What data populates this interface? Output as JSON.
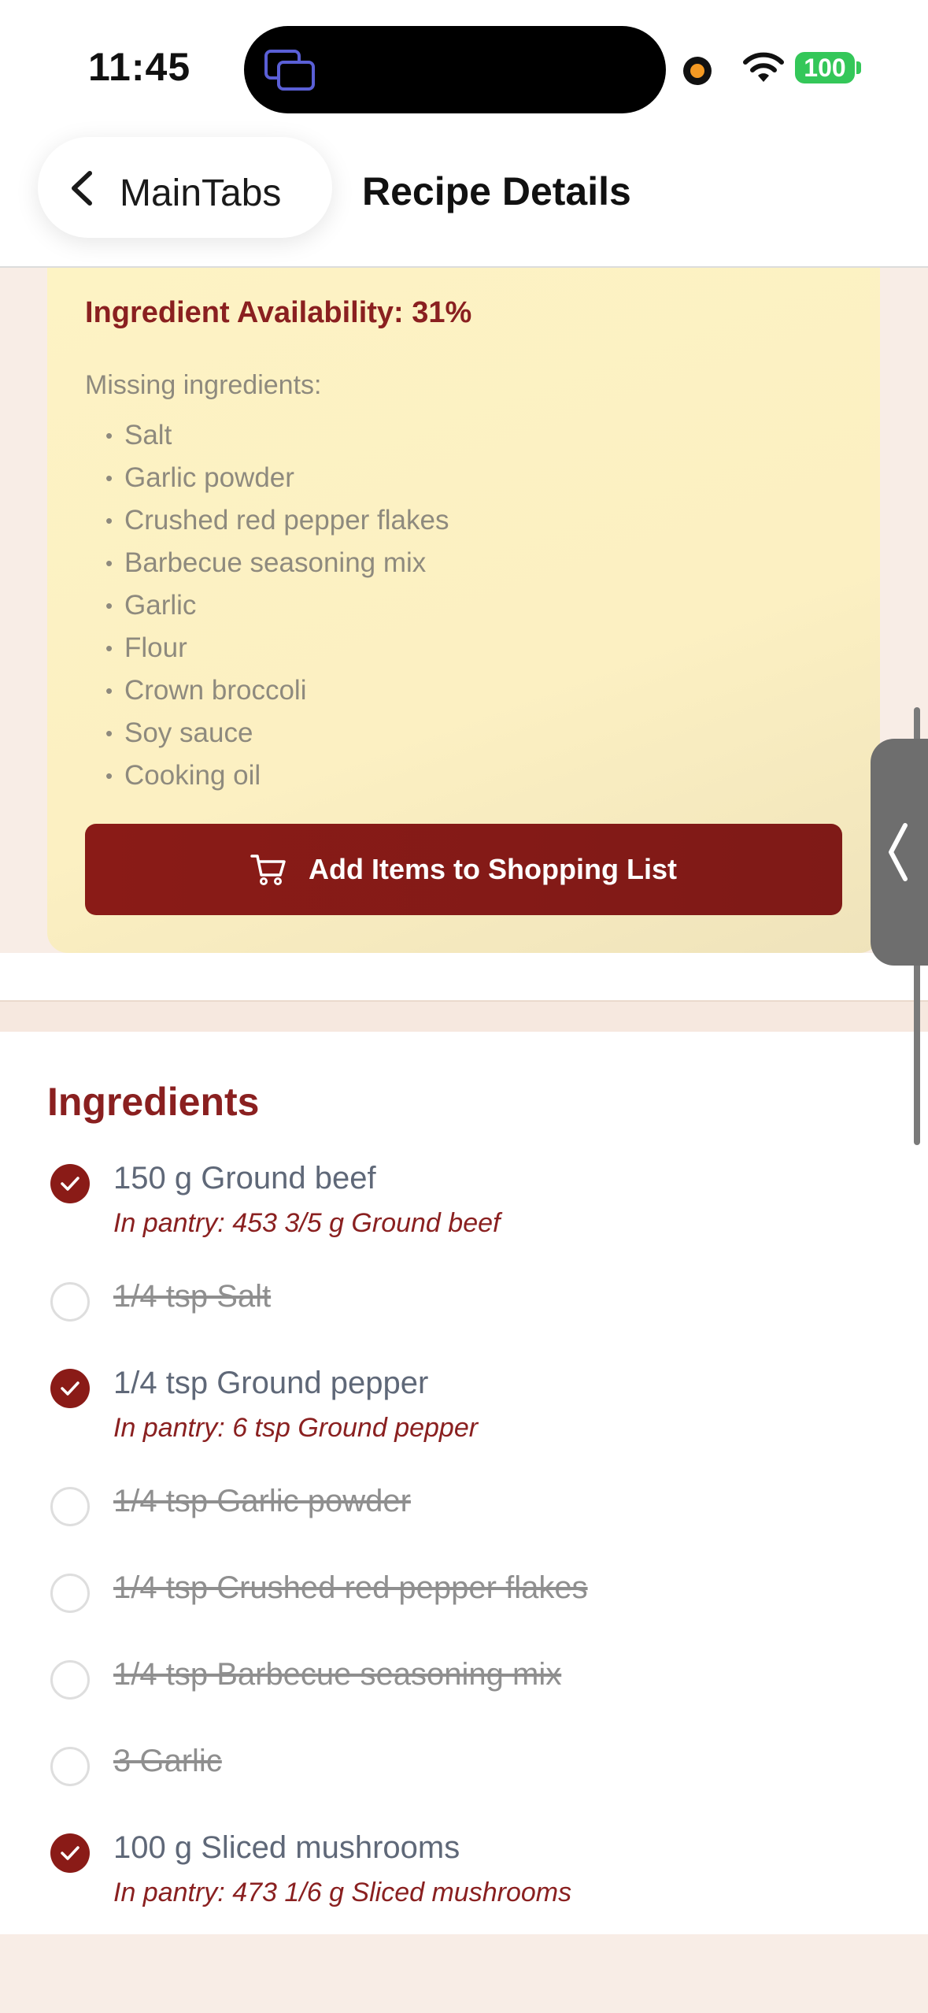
{
  "status_bar": {
    "time": "11:45",
    "battery": "100"
  },
  "nav": {
    "back_label": "MainTabs",
    "title": "Recipe Details"
  },
  "availability": {
    "title": "Ingredient Availability: 31%",
    "missing_label": "Missing ingredients:",
    "missing": [
      "Salt",
      "Garlic powder",
      "Crushed red pepper flakes",
      "Barbecue seasoning mix",
      "Garlic",
      "Flour",
      "Crown broccoli",
      "Soy sauce",
      "Cooking oil"
    ],
    "button_label": "Add Items to Shopping List"
  },
  "ingredients": {
    "title": "Ingredients",
    "items": [
      {
        "name": "150 g Ground beef",
        "available": true,
        "pantry": "In pantry: 453 3/5 g Ground beef"
      },
      {
        "name": "1/4 tsp Salt",
        "available": false,
        "pantry": ""
      },
      {
        "name": "1/4 tsp Ground pepper",
        "available": true,
        "pantry": "In pantry: 6 tsp Ground pepper"
      },
      {
        "name": "1/4 tsp Garlic powder",
        "available": false,
        "pantry": ""
      },
      {
        "name": "1/4 tsp Crushed red pepper flakes",
        "available": false,
        "pantry": ""
      },
      {
        "name": "1/4 tsp Barbecue seasoning mix",
        "available": false,
        "pantry": ""
      },
      {
        "name": "3 Garlic",
        "available": false,
        "pantry": ""
      },
      {
        "name": "100 g Sliced mushrooms",
        "available": true,
        "pantry": "In pantry: 473 1/6 g Sliced mushrooms"
      }
    ]
  },
  "colors": {
    "accent": "#8a1b17",
    "card_bg": "#fdf3c4",
    "muted_text": "#8e8a7e"
  }
}
